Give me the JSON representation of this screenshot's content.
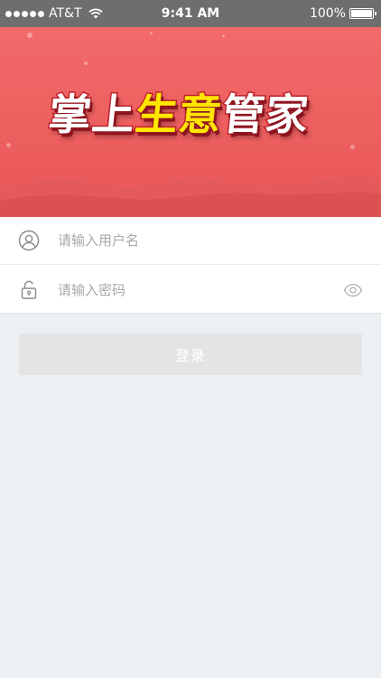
{
  "status_bar": {
    "carrier": "AT&T",
    "time": "9:41 AM",
    "battery": "100%",
    "signal_bars": 5,
    "battery_level": 1.0
  },
  "banner": {
    "title_part1": "掌上",
    "title_part2": "生意",
    "title_part3": "管家",
    "colors": {
      "top": "#f26a6a",
      "bottom": "#e85757",
      "title_white": "#ffffff",
      "title_yellow": "#ffe600"
    }
  },
  "login_form": {
    "username_placeholder": "请输入用户名",
    "password_placeholder": "请输入密码",
    "username_value": "",
    "password_value": "",
    "user_icon": "user-icon",
    "lock_icon": "lock-icon",
    "eye_icon": "eye-icon"
  },
  "login_button": {
    "label": "登录",
    "background": "#e4e4e4"
  }
}
